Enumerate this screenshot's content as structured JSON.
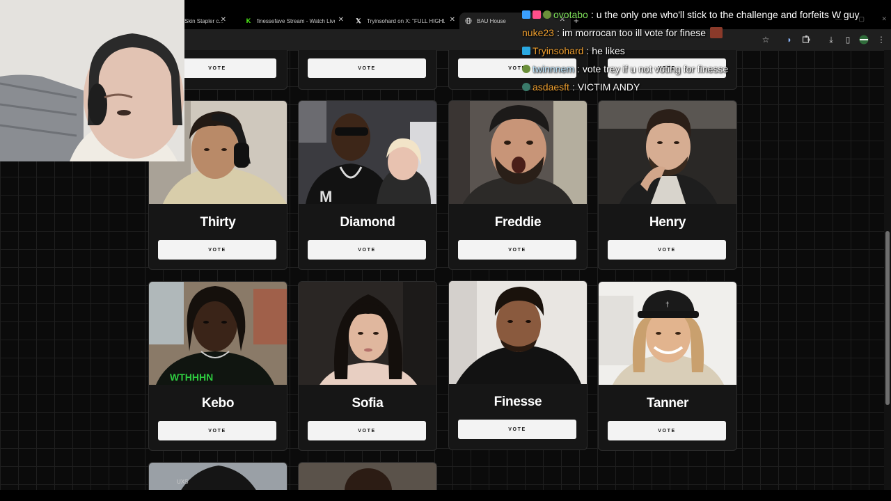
{
  "browser": {
    "tabs": [
      {
        "title": "Skin Stapler c...",
        "favicon": "page-icon"
      },
      {
        "title": "finessefave Stream - Watch Live",
        "favicon": "kick-icon"
      },
      {
        "title": "Tryinsohard on X: \"FULL HIGHL",
        "favicon": "x-icon"
      },
      {
        "title": "BAU House",
        "favicon": "globe-icon",
        "active": true
      }
    ],
    "new_tab_symbol": "+"
  },
  "contestants": {
    "vote_label": "VOTE",
    "rows": [
      [
        {
          "name": "Thirty"
        },
        {
          "name": "Diamond"
        },
        {
          "name": "Freddie"
        },
        {
          "name": "Henry"
        }
      ],
      [
        {
          "name": "Kebo"
        },
        {
          "name": "Sofia"
        },
        {
          "name": "Finesse"
        },
        {
          "name": "Tanner"
        }
      ]
    ]
  },
  "chat": {
    "messages": [
      {
        "user": "ovotabo",
        "user_color": "#7ee05a",
        "text": "u the only one who'll stick to the challenge and forfeits W guy",
        "badges": [
          "pixel-badge",
          "gift-badge",
          "frog-badge"
        ]
      },
      {
        "user": "nuke23",
        "user_color": "#f0a030",
        "text": "im morrocan too ill vote for finese",
        "badges": [],
        "emote": "face-emote"
      },
      {
        "user": "Tryinsohard",
        "user_color": "#f0a030",
        "text": "he likes",
        "badges": [
          "cube-badge"
        ]
      },
      {
        "user": "twinnnem",
        "user_color": "#bfe7ff",
        "text": "vote trey if u not voting for finesse",
        "badges": [
          "frog-badge"
        ]
      },
      {
        "user": "asdaesft",
        "user_color": "#f0a030",
        "text": "VICTIM ANDY",
        "badges": [
          "frog-badge"
        ]
      }
    ]
  },
  "colors": {
    "page_bg": "#0b0b0b",
    "card_bg": "#161616",
    "vote_bg": "#f3f3f3"
  }
}
